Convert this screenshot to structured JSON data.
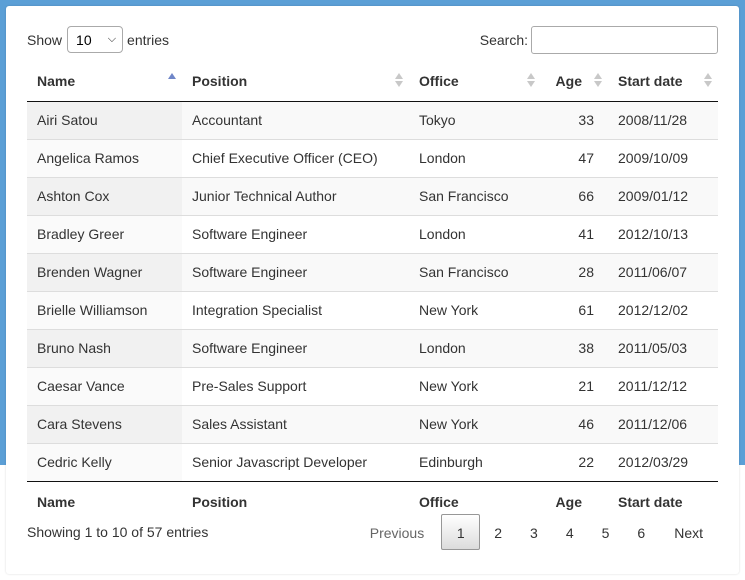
{
  "controls": {
    "show_label": "Show",
    "entries_value": "10",
    "entries_label": "entries",
    "search_label": "Search:",
    "search_value": ""
  },
  "columns": [
    "Name",
    "Position",
    "Office",
    "Age",
    "Start date"
  ],
  "rows": [
    [
      "Airi Satou",
      "Accountant",
      "Tokyo",
      "33",
      "2008/11/28"
    ],
    [
      "Angelica Ramos",
      "Chief Executive Officer (CEO)",
      "London",
      "47",
      "2009/10/09"
    ],
    [
      "Ashton Cox",
      "Junior Technical Author",
      "San Francisco",
      "66",
      "2009/01/12"
    ],
    [
      "Bradley Greer",
      "Software Engineer",
      "London",
      "41",
      "2012/10/13"
    ],
    [
      "Brenden Wagner",
      "Software Engineer",
      "San Francisco",
      "28",
      "2011/06/07"
    ],
    [
      "Brielle Williamson",
      "Integration Specialist",
      "New York",
      "61",
      "2012/12/02"
    ],
    [
      "Bruno Nash",
      "Software Engineer",
      "London",
      "38",
      "2011/05/03"
    ],
    [
      "Caesar Vance",
      "Pre-Sales Support",
      "New York",
      "21",
      "2011/12/12"
    ],
    [
      "Cara Stevens",
      "Sales Assistant",
      "New York",
      "46",
      "2011/12/06"
    ],
    [
      "Cedric Kelly",
      "Senior Javascript Developer",
      "Edinburgh",
      "22",
      "2012/03/29"
    ]
  ],
  "info": "Showing 1 to 10 of 57 entries",
  "pagination": {
    "previous": "Previous",
    "pages": [
      "1",
      "2",
      "3",
      "4",
      "5",
      "6"
    ],
    "next": "Next"
  },
  "colors": {
    "header_band": "#5b9fd6",
    "sort_active": "#6f86c8"
  }
}
